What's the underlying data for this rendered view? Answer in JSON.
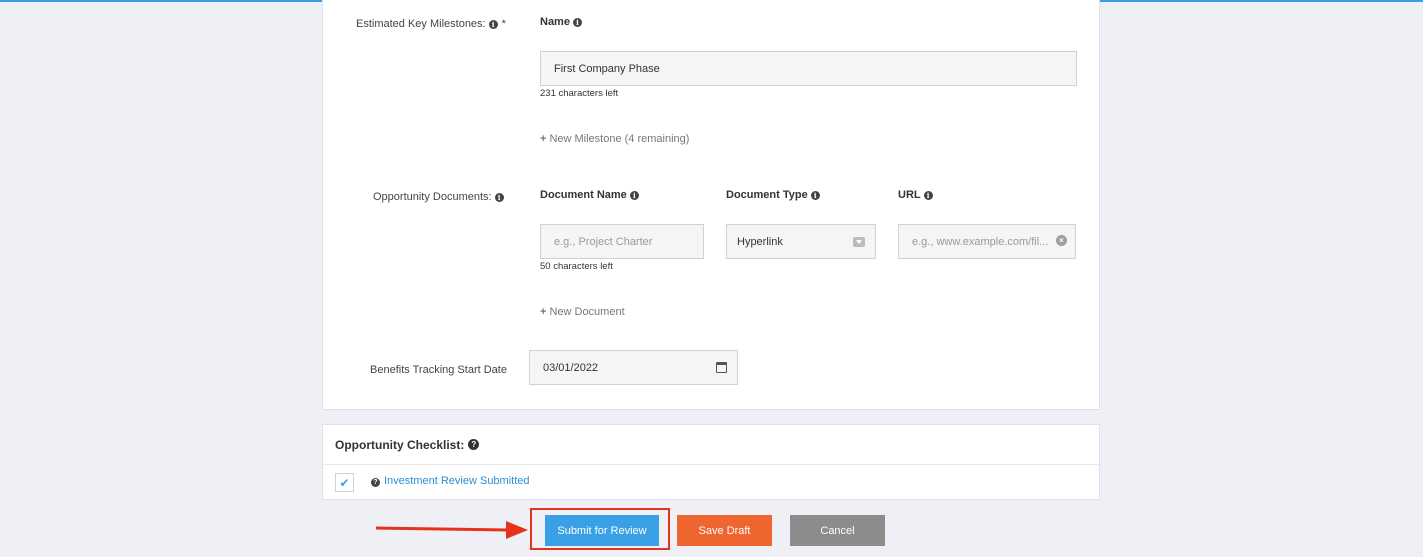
{
  "milestones": {
    "label": "Estimated Key Milestones:",
    "required_mark": "*",
    "name_header": "Name",
    "name_value": "First Company Phase",
    "name_help": "231 characters left",
    "add_label": "New Milestone (4 remaining)"
  },
  "documents": {
    "label": "Opportunity Documents:",
    "col_name": "Document Name",
    "col_type": "Document Type",
    "col_url": "URL",
    "name_placeholder": "e.g., Project Charter",
    "name_help": "50 characters left",
    "type_value": "Hyperlink",
    "url_placeholder": "e.g., www.example.com/fil...",
    "add_label": "New Document"
  },
  "benefits": {
    "label": "Benefits Tracking Start Date",
    "date_value": "03/01/2022"
  },
  "checklist": {
    "title": "Opportunity Checklist:",
    "items": [
      {
        "label": "Investment Review Submitted",
        "checked": true
      }
    ]
  },
  "actions": {
    "submit_label": "Submit for Review",
    "save_label": "Save Draft",
    "cancel_label": "Cancel"
  },
  "colors": {
    "primary": "#3aa0e6",
    "save": "#ef6530",
    "cancel": "#8c8c8c",
    "highlight": "#e5321d",
    "link": "#2a8fd6"
  },
  "icons": {
    "info": "info-icon",
    "help": "question-circle-icon",
    "calendar": "calendar-icon",
    "clear": "clear-icon",
    "dropdown": "dropdown-arrow-icon",
    "check": "check-icon",
    "annotation": "arrow-annotation"
  }
}
